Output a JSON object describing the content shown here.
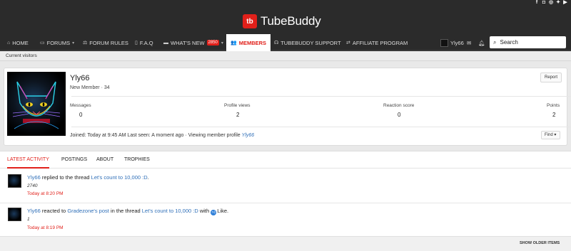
{
  "header": {
    "logo_mark": "tb",
    "logo_text": "TubeBuddy",
    "social_icons": [
      "facebook-icon",
      "discord-icon",
      "instagram-icon",
      "twitter-icon",
      "youtube-icon"
    ]
  },
  "nav": {
    "home": "HOME",
    "forums": "FORUMS",
    "forum_rules": "FORUM RULES",
    "faq": "F.A.Q",
    "whats_new": "WHAT'S NEW",
    "whats_new_badge": "2850",
    "members": "MEMBERS",
    "support": "TUBEBUDDY SUPPORT",
    "affiliate": "AFFILIATE PROGRAM",
    "username": "Yly66",
    "search_label": "Search"
  },
  "subnav": {
    "current_visitors": "Current visitors"
  },
  "profile": {
    "username": "Yly66",
    "title": "New Member · 34",
    "report_label": "Report",
    "find_label": "Find",
    "stats": [
      {
        "label": "Messages",
        "value": "0"
      },
      {
        "label": "Profile views",
        "value": "2"
      },
      {
        "label": "Reaction score",
        "value": "0"
      },
      {
        "label": "Points",
        "value": "2"
      }
    ],
    "joined_text": "Joined: Today at 9:45 AM   Last seen: A moment ago · Viewing member profile",
    "joined_link": "Yly66"
  },
  "tabs": [
    "LATEST ACTIVITY",
    "POSTINGS",
    "ABOUT",
    "TROPHIES"
  ],
  "activity": [
    {
      "user": "Yly66",
      "action": "replied to the thread",
      "thread": "Let's count to 10,000 :D",
      "trail": ".",
      "snippet": "2740",
      "time": "Today at 8:20 PM"
    },
    {
      "user": "Yly66",
      "action": "reacted to",
      "post_link": "Gradezone's post",
      "in_thread": "in the thread",
      "thread": "Let's count to 10,000 :D",
      "with_text": "with",
      "reaction": "Like.",
      "snippet": "1",
      "time": "Today at 8:19 PM"
    }
  ],
  "show_older": "SHOW OLDER ITEMS",
  "colors": {
    "accent": "#e1201a",
    "link": "#2f6fb8",
    "header_bg": "#2b2b2b"
  }
}
